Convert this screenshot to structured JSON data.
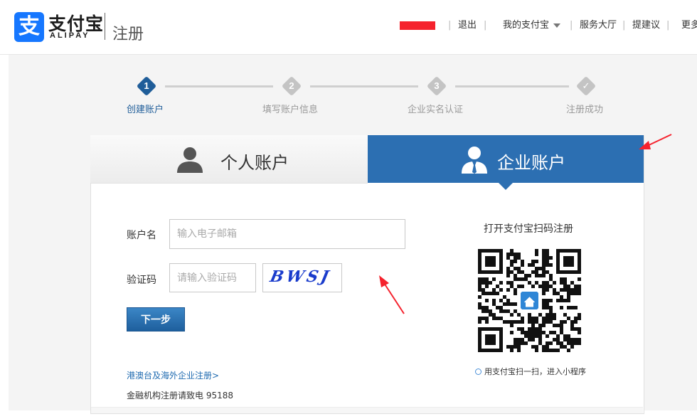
{
  "header": {
    "logo_glyph": "支",
    "brand_cn": "支付宝",
    "brand_en": "ALIPAY",
    "page_title": "注册",
    "nav": {
      "logout": "退出",
      "my_alipay": "我的支付宝",
      "service_hall": "服务大厅",
      "feedback": "提建议",
      "more": "更多"
    }
  },
  "steps": [
    {
      "num": "1",
      "label": "创建账户",
      "state": "active"
    },
    {
      "num": "2",
      "label": "填写账户信息",
      "state": "pending"
    },
    {
      "num": "3",
      "label": "企业实名认证",
      "state": "pending"
    },
    {
      "num": "✓",
      "label": "注册成功",
      "state": "pending"
    }
  ],
  "tabs": {
    "personal": "个人账户",
    "company": "企业账户",
    "selected": "company"
  },
  "form": {
    "account_label": "账户名",
    "account_placeholder": "输入电子邮箱",
    "captcha_label": "验证码",
    "captcha_placeholder": "请输入验证码",
    "captcha_text": "BWSJ",
    "next_button": "下一步",
    "overseas_link": "港澳台及海外企业注册>",
    "hotline_label": "金融机构注册请致电",
    "hotline_number": "95188"
  },
  "qr": {
    "title": "打开支付宝扫码注册",
    "caption": "用支付宝扫一扫，进入小程序"
  },
  "colors": {
    "brand_blue": "#1677ff",
    "active_tab": "#2c6fb2",
    "step_active": "#1f5d99",
    "step_pending": "#c4c4c4",
    "annotation_red": "#f5222d"
  }
}
